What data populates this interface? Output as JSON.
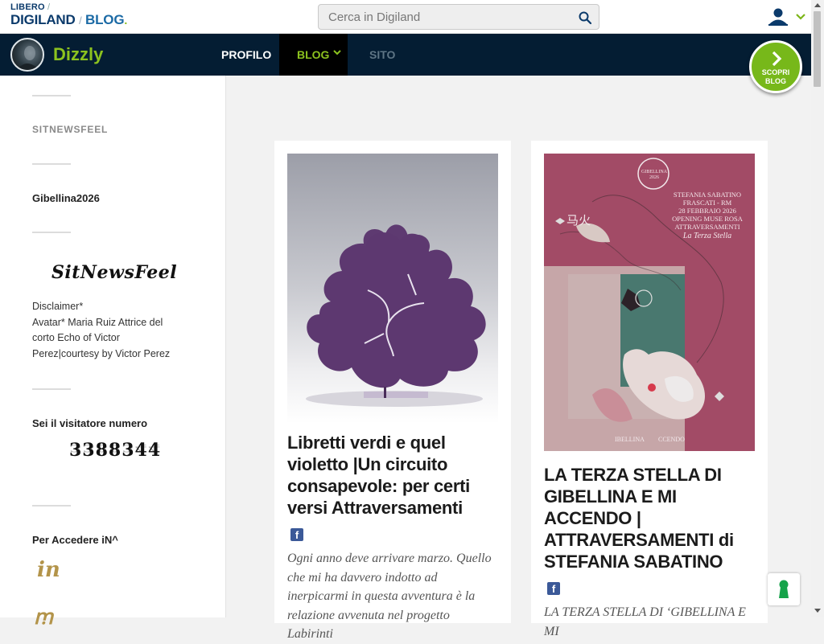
{
  "header": {
    "logo_line1": "LIBERO",
    "logo_line1_sep": "/",
    "logo_digiland": "DIGILAND",
    "logo_sep": "/",
    "logo_blog": "BLOG",
    "logo_dot": ".",
    "search_placeholder": "Cerca in Digiland",
    "user_icon": "user-icon"
  },
  "nav": {
    "blog_name": "Dizzly",
    "items": [
      {
        "label": "PROFILO"
      },
      {
        "label": "BLOG"
      },
      {
        "label": "SITO"
      }
    ],
    "scopri_line1": "SCOPRI",
    "scopri_line2": "BLOG"
  },
  "sidebar": {
    "section1_title": "SITNEWSFEEL",
    "section2_title": "Gibellina2026",
    "logo_text": "SitNewsFeel",
    "disclaimer": "Disclaimer*\nAvatar* Maria Ruiz Attrice del corto Echo of Victor Perez|courtesy by Victor Perez",
    "visitor_title": "Sei il visitatore numero",
    "visitor_count": "3388344",
    "access_title": "Per Accedere iN^",
    "access_logo": "in"
  },
  "posts": [
    {
      "title": "Libretti verdi e quel violetto |Un circuito consapevole: per certi versi Attraversamenti",
      "share": "f",
      "excerpt": "Ogni anno deve arrivare marzo. Quello che mi ha davvero indotto ad inerpicarmi in questa avventura è la relazione avvenuta nel progetto Labirinti"
    },
    {
      "title": "LA TERZA STELLA DI GIBELLINA E MI ACCENDO | ATTRAVERSAMENTI di STEFANIA SABATINO",
      "share": "f",
      "excerpt": "LA TERZA STELLA DI ‘GIBELLINA E MI",
      "image_text": {
        "badge": "GIBELLINA 2026",
        "lines": [
          "STEFANIA SABATINO",
          "FRASCATI - RM",
          "28 FEBBRAIO 2026",
          "OPENING MUSE ROSA",
          "ATTRAVERSAMENTI"
        ],
        "signature": "La Terza Stella",
        "chinese": "马火",
        "footer_left": "IBELLINA",
        "footer_right": "CCENDO"
      }
    }
  ],
  "colors": {
    "nav_bg": "#041d33",
    "accent_green": "#8cc21f",
    "facebook": "#3b5998"
  }
}
